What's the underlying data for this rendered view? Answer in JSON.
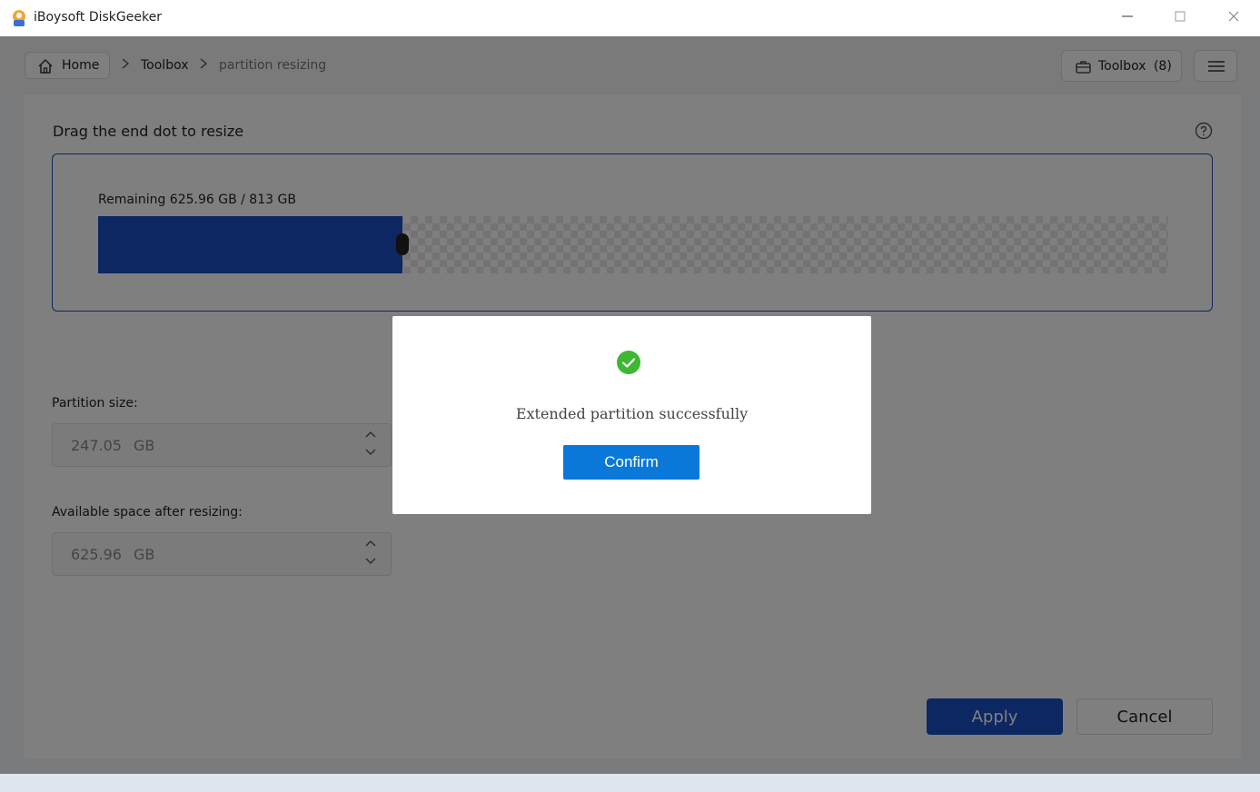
{
  "window": {
    "title": "iBoysoft DiskGeeker",
    "minimize_icon": "minimize-icon",
    "maximize_icon": "maximize-icon",
    "close_icon": "close-icon"
  },
  "breadcrumb": {
    "home": "Home",
    "toolbox": "Toolbox",
    "current": "partition resizing"
  },
  "header": {
    "toolbox_label": "Toolbox",
    "toolbox_count": "(8)"
  },
  "resize": {
    "title": "Drag the end dot to resize",
    "remaining": "Remaining 625.96 GB / 813 GB",
    "fill_fraction": 0.284
  },
  "partition_size": {
    "label": "Partition size:",
    "value": "247.05",
    "unit": "GB"
  },
  "available_space": {
    "label": "Available space after resizing:",
    "value": "625.96",
    "unit": "GB"
  },
  "actions": {
    "apply": "Apply",
    "cancel": "Cancel"
  },
  "dialog": {
    "message": "Extended partition successfully",
    "confirm": "Confirm"
  },
  "colors": {
    "accent": "#1a4fc4",
    "confirm": "#0a78d8",
    "success": "#3db832"
  }
}
